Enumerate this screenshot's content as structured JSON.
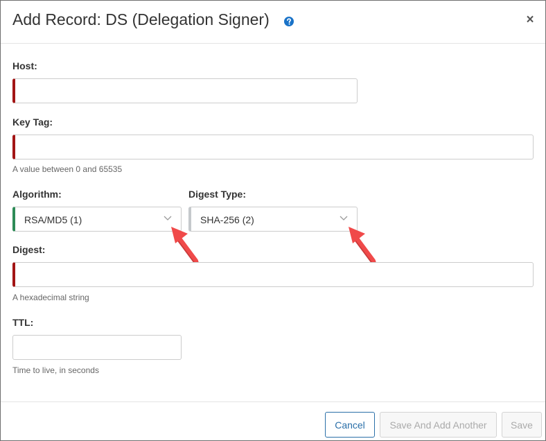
{
  "dialog": {
    "title": "Add Record: DS (Delegation Signer)",
    "help_icon": "question-circle-icon",
    "close_label": "×"
  },
  "form": {
    "host": {
      "label": "Host:",
      "value": ""
    },
    "key_tag": {
      "label": "Key Tag:",
      "value": "",
      "hint": "A value between 0 and 65535"
    },
    "algorithm": {
      "label": "Algorithm:",
      "selected": "RSA/MD5 (1)"
    },
    "digest_type": {
      "label": "Digest Type:",
      "selected": "SHA-256 (2)"
    },
    "digest": {
      "label": "Digest:",
      "value": "",
      "hint": "A hexadecimal string"
    },
    "ttl": {
      "label": "TTL:",
      "value": "",
      "hint": "Time to live, in seconds"
    }
  },
  "footer": {
    "cancel_label": "Cancel",
    "save_another_label": "Save And Add Another",
    "save_label": "Save"
  },
  "colors": {
    "required_marker": "#a31515",
    "valid_marker": "#2e8b57",
    "primary": "#2a6fa8",
    "annotation_arrow": "#f04a4a"
  }
}
